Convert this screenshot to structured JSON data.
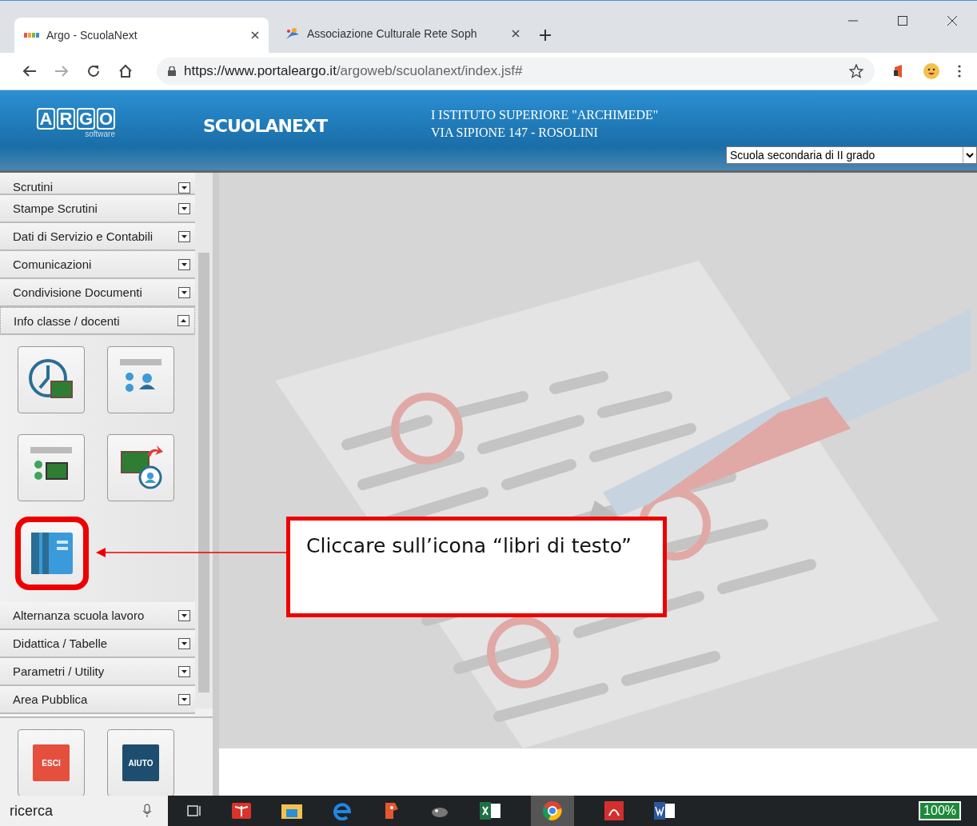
{
  "browser": {
    "tabs": [
      {
        "title": "Argo - ScuolaNext",
        "selected": true
      },
      {
        "title": "Associazione Culturale Rete Soph",
        "selected": false
      }
    ],
    "url_host": "https://www.portaleargo.it",
    "url_path": "/argoweb/scuolanext/index.jsf#"
  },
  "header": {
    "logo_letters": [
      "A",
      "R",
      "G",
      "O"
    ],
    "logo_sub": "software",
    "app_name": "SCUOLANEXT",
    "school_lines": [
      "I ISTITUTO SUPERIORE \"ARCHIMEDE\"",
      "VIA SIPIONE 147 - ROSOLINI"
    ],
    "school_select": "Scuola secondaria di II grado"
  },
  "sidebar": {
    "sections": [
      {
        "label": "Scrutini",
        "expanded": false
      },
      {
        "label": "Stampe Scrutini",
        "expanded": false
      },
      {
        "label": "Dati di Servizio e Contabili",
        "expanded": false
      },
      {
        "label": "Comunicazioni",
        "expanded": false
      },
      {
        "label": "Condivisione Documenti",
        "expanded": false
      },
      {
        "label": "Info classe / docenti",
        "expanded": true,
        "tiles": [
          {
            "kind": "clock",
            "highlighted": false
          },
          {
            "kind": "people",
            "highlighted": false
          },
          {
            "kind": "class",
            "highlighted": false
          },
          {
            "kind": "transfer",
            "highlighted": false
          },
          {
            "kind": "books",
            "highlighted": true
          }
        ]
      },
      {
        "label": "Alternanza scuola lavoro",
        "expanded": false
      },
      {
        "label": "Didattica / Tabelle",
        "expanded": false
      },
      {
        "label": "Parametri / Utility",
        "expanded": false
      },
      {
        "label": "Area Pubblica",
        "expanded": false
      }
    ],
    "buttons": [
      {
        "label": "ESCI",
        "kind": "exit"
      },
      {
        "label": "AIUTO",
        "kind": "help"
      }
    ]
  },
  "annotation": {
    "text": "Cliccare sull’icona “libri di testo”"
  },
  "taskbar": {
    "search": "ricerca",
    "battery": "100%"
  }
}
